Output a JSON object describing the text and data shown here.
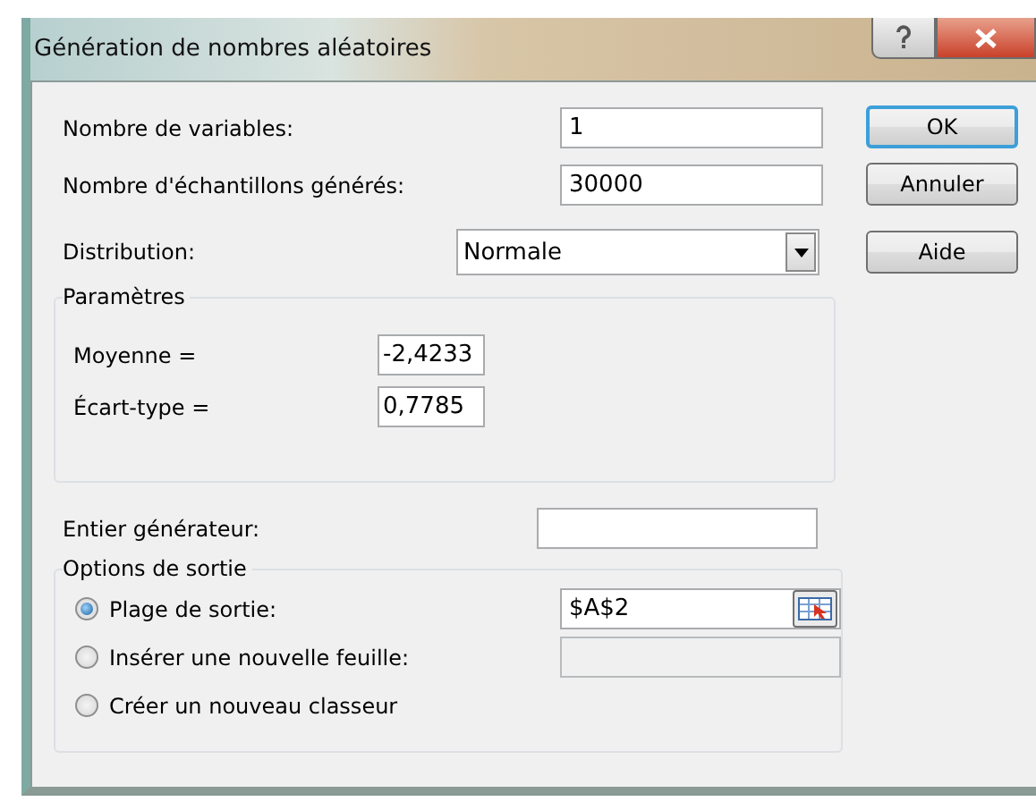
{
  "window": {
    "title": "Génération de nombres aléatoires"
  },
  "fields": [
    {
      "label": "Nombre de variables:",
      "value": "1"
    },
    {
      "label": "Nombre d'échantillons générés:",
      "value": "30000"
    }
  ],
  "distribution": {
    "label": "Distribution:",
    "value": "Normale"
  },
  "parameters": {
    "title": "Paramètres",
    "items": [
      {
        "label": "Moyenne =",
        "value": "-2,4233"
      },
      {
        "label": "Écart-type =",
        "value": "0,7785"
      }
    ]
  },
  "seed": {
    "label": "Entier générateur:"
  },
  "output": {
    "title": "Options de sortie",
    "options": [
      {
        "label": "Plage de sortie:",
        "selected": true,
        "field": {
          "value": "$A$2",
          "disabled": false,
          "ref_button": true
        }
      },
      {
        "label": "Insérer une nouvelle feuille:",
        "selected": false,
        "field": {
          "disabled": true,
          "ref_button": false
        }
      },
      {
        "label": "Créer un nouveau classeur",
        "selected": false
      }
    ]
  },
  "buttons": [
    {
      "label": "OK",
      "focused": true
    },
    {
      "label": "Annuler",
      "focused": false
    },
    {
      "label": "Aide",
      "focused": false
    }
  ]
}
